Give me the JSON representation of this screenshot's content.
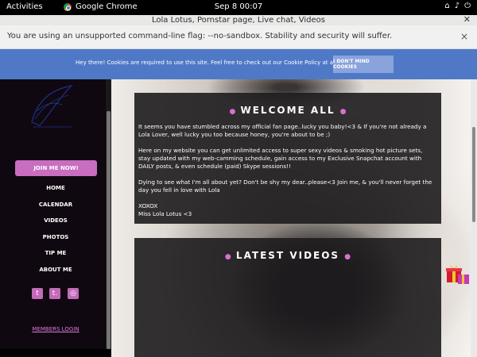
{
  "topbar": {
    "activities": "Activities",
    "app_name": "Google Chrome",
    "clock": "Sep 8  00:07"
  },
  "window": {
    "title": "Lola Lotus, Pornstar page, Live chat, Videos"
  },
  "infobar": {
    "message": "You are using an unsupported command-line flag: --no-sandbox. Stability and security will suffer.",
    "close": "×"
  },
  "cookie": {
    "text": "Hey there! Cookies are required to use this site. Feel free to check out our Cookie Policy at any time.",
    "button": "I DON'T MIND COOKIES",
    "color": "#4f79c6"
  },
  "sidebar": {
    "join": "JOIN ME NOW!",
    "nav": [
      "HOME",
      "CALENDAR",
      "VIDEOS",
      "PHOTOS",
      "TIP ME",
      "ABOUT ME"
    ],
    "social": [
      "t",
      "t.",
      "◎"
    ],
    "members": "MEMBERS LOGIN",
    "accent": "#c96dc1"
  },
  "welcome": {
    "title": "WELCOME ALL",
    "p1": "It seems you have stumbled across my official fan page..lucky you baby!<3 & If you're not already a Lola Lover, well lucky you too because honey, you're about to be ;)",
    "p2": "Here on my website you can get unlimited access to super sexy videos & smoking hot picture sets, stay updated with my web-camming schedule, gain access to my Exclusive Snapchat account with DAILY posts, & even schedule (paid) Skype sessions!!",
    "p3": "Dying to see what I'm all about yet? Don't be shy my dear..please<3 Join me, & you'll never forget the day you fell in love with Lola",
    "sign1": "XOXOX",
    "sign2": "Miss Lola Lotus <3"
  },
  "videos": {
    "title": "LATEST VIDEOS"
  }
}
